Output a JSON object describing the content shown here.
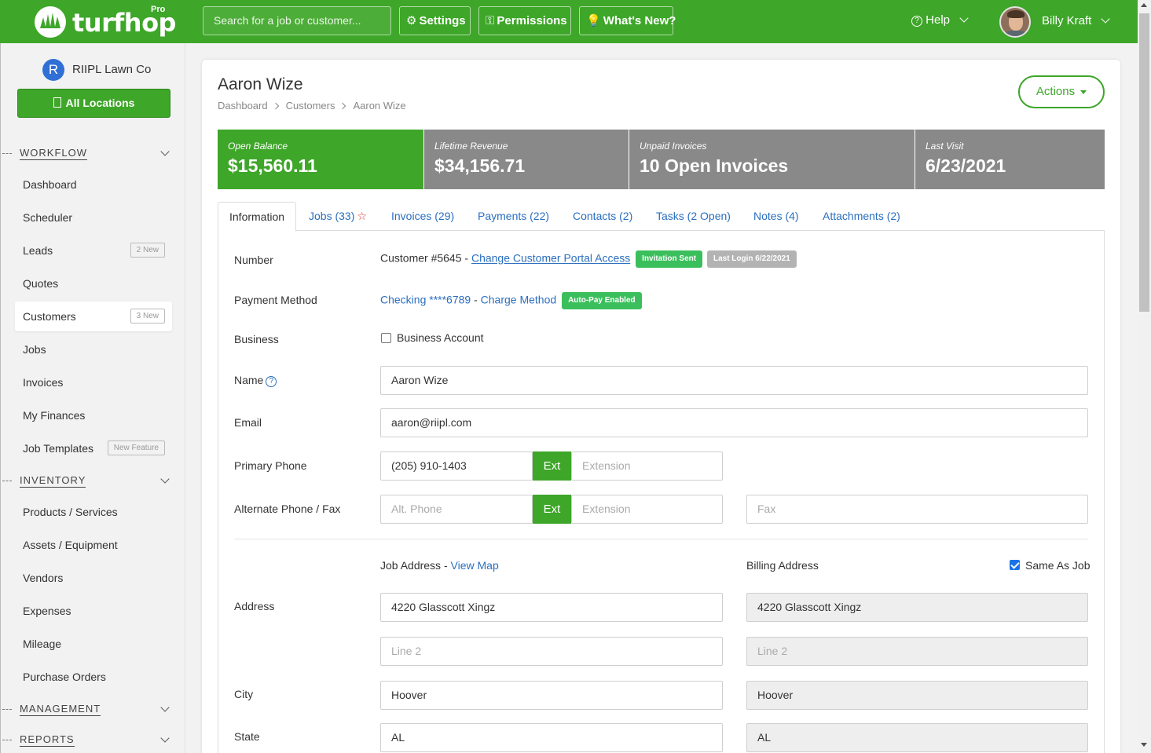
{
  "brand": {
    "name": "turfhop",
    "tier": "Pro"
  },
  "topbar": {
    "search_placeholder": "Search for a job or customer...",
    "settings": "Settings",
    "permissions": "Permissions",
    "whats_new": "What's New?",
    "help": "Help",
    "user_name": "Billy Kraft"
  },
  "sidebar": {
    "company_initial": "R",
    "company_name": "RIIPL Lawn Co",
    "all_locations": "All Locations",
    "sections": {
      "workflow": "WORKFLOW",
      "inventory": "INVENTORY",
      "management": "MANAGEMENT",
      "reports": "REPORTS"
    },
    "workflow_items": [
      {
        "label": "Dashboard"
      },
      {
        "label": "Scheduler"
      },
      {
        "label": "Leads",
        "badge": "2 New"
      },
      {
        "label": "Quotes"
      },
      {
        "label": "Customers",
        "badge": "3 New"
      },
      {
        "label": "Jobs"
      },
      {
        "label": "Invoices"
      },
      {
        "label": "My Finances"
      },
      {
        "label": "Job Templates",
        "badge": "New Feature"
      }
    ],
    "inventory_items": [
      {
        "label": "Products / Services"
      },
      {
        "label": "Assets / Equipment"
      },
      {
        "label": "Vendors"
      },
      {
        "label": "Expenses"
      },
      {
        "label": "Mileage"
      },
      {
        "label": "Purchase Orders"
      }
    ]
  },
  "customer": {
    "title": "Aaron Wize",
    "breadcrumb": [
      "Dashboard",
      "Customers",
      "Aaron Wize"
    ],
    "actions": "Actions"
  },
  "stats": [
    {
      "label": "Open Balance",
      "value": "$15,560.11"
    },
    {
      "label": "Lifetime Revenue",
      "value": "$34,156.71"
    },
    {
      "label": "Unpaid Invoices",
      "value": "10 Open Invoices"
    },
    {
      "label": "Last Visit",
      "value": "6/23/2021"
    }
  ],
  "tabs": [
    "Information",
    "Jobs (33)",
    "Invoices (29)",
    "Payments (22)",
    "Contacts (2)",
    "Tasks (2 Open)",
    "Notes (4)",
    "Attachments (2)"
  ],
  "tab_star": "☆",
  "form": {
    "number_label": "Number",
    "customer_number": "Customer #5645 - ",
    "portal_link": "Change Customer Portal Access",
    "invitation_badge": "Invitation Sent",
    "last_login_badge": "Last Login 6/22/2021",
    "payment_label": "Payment Method",
    "payment_value": "Checking ****6789",
    "payment_sep": " - ",
    "charge_link": "Charge Method",
    "autopay_badge": "Auto-Pay Enabled",
    "business_label": "Business",
    "business_checkbox": "Business Account",
    "name_label": "Name",
    "name_value": "Aaron Wize",
    "email_label": "Email",
    "email_value": "aaron@riipl.com",
    "phone_label": "Primary Phone",
    "phone_value": "(205) 910-1403",
    "ext_button": "Ext",
    "extension_placeholder": "Extension",
    "alt_label": "Alternate Phone / Fax",
    "alt_placeholder": "Alt. Phone",
    "fax_placeholder": "Fax",
    "job_address_label": "Job Address",
    "view_map": "View Map",
    "billing_label": "Billing Address",
    "same_as_job": "Same As Job",
    "address_label": "Address",
    "address_line1": "4220 Glasscott Xingz",
    "line2_placeholder": "Line 2",
    "city_label": "City",
    "city_value": "Hoover",
    "state_label": "State",
    "state_value": "AL"
  }
}
